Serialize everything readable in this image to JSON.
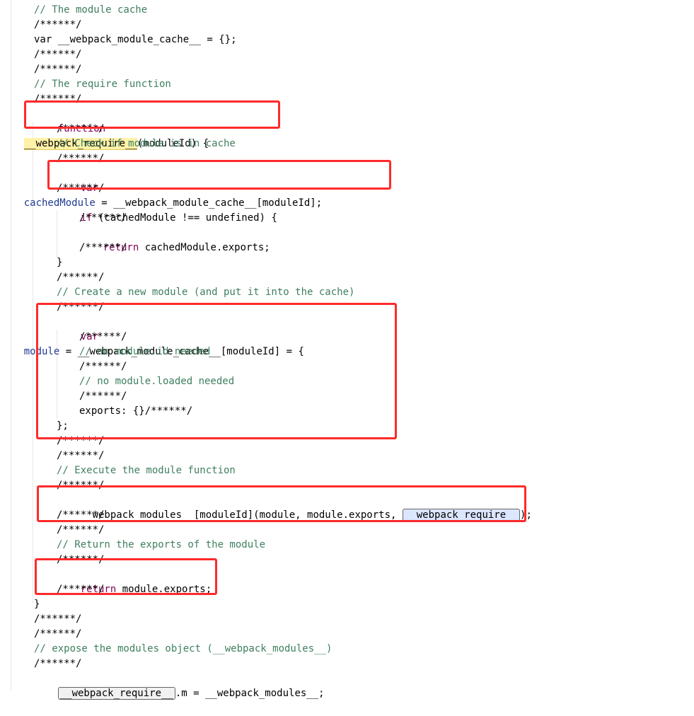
{
  "lines": {
    "l1": "// The module cache",
    "l2": "/******/",
    "l3": "var __webpack_module_cache__ = {};",
    "l4": "/******/",
    "l5": "/******/",
    "l6": "// The require function",
    "l7": "/******/",
    "l8a": "function",
    "l8b": "__webpack_require__",
    "l8c": "(moduleId) {",
    "l9": "/******/",
    "l10": "// Check if module is in cache",
    "l11": "/******/",
    "l12a": "var",
    "l12b": "cachedModule",
    "l12c": " = __webpack_module_cache__[moduleId];",
    "l13": "/******/",
    "l14a": "if",
    "l14b": " (cachedModule !== undefined) {",
    "l15": "/******/",
    "l16a": "return",
    "l16b": " cachedModule.exports;",
    "l17": "/******/",
    "l18": "}",
    "l19": "/******/",
    "l20": "// Create a new module (and put it into the cache)",
    "l21": "/******/",
    "l22a": "var",
    "l22b": "module",
    "l22c": " = __webpack_module_cache__[moduleId] = {",
    "l23": "/******/",
    "l24": "// no module.id needed",
    "l25": "/******/",
    "l26": "// no module.loaded needed",
    "l27": "/******/",
    "l28": "exports: {}/******/",
    "l29": "};",
    "l30": "/******/",
    "l31": "/******/",
    "l32": "// Execute the module function",
    "l33": "/******/",
    "l34a": "__webpack_modules__[moduleId](module, module.exports, ",
    "l34b": "__webpack_require__",
    "l34c": ");",
    "l35": "/******/",
    "l36": "/******/",
    "l37": "// Return the exports of the module",
    "l38": "/******/",
    "l39a": "return",
    "l39b": " module.exports;",
    "l40": "/******/",
    "l41": "}",
    "l42": "/******/",
    "l43": "/******/",
    "l44": "// expose the modules object (__webpack_modules__)",
    "l45": "/******/",
    "l46a": "__webpack_require__",
    "l46b": ".m = __webpack_modules__;"
  },
  "colors": {
    "annotation": "#ff2a2a",
    "comment": "#3f7f5f",
    "keyword": "#7f0055"
  }
}
